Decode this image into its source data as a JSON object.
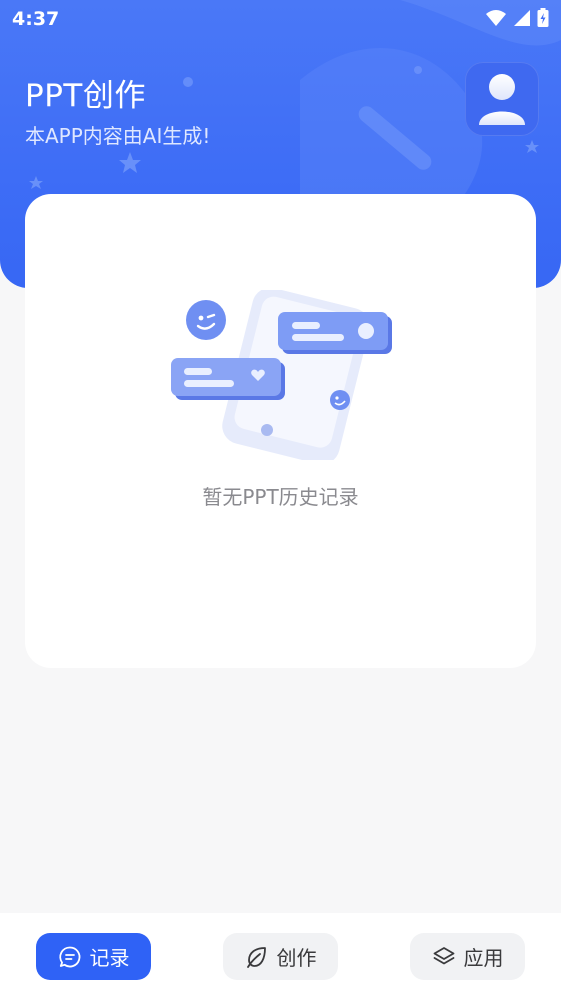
{
  "status": {
    "time": "4:37"
  },
  "header": {
    "title": "PPT创作",
    "subtitle": "本APP内容由AI生成!"
  },
  "records": {
    "empty_text": "暂无PPT历史记录"
  },
  "nav": {
    "items": [
      {
        "label": "记录",
        "icon": "chat-bubble-icon",
        "active": true
      },
      {
        "label": "创作",
        "icon": "leaf-icon",
        "active": false
      },
      {
        "label": "应用",
        "icon": "layers-icon",
        "active": false
      }
    ]
  },
  "colors": {
    "primary": "#2f62f6",
    "header": "#4a78f7",
    "background": "#f7f7f8"
  }
}
